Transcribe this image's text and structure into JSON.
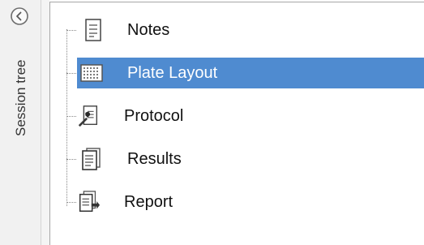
{
  "side_panel": {
    "title": "Session tree",
    "collapse_icon": "chevron-left-circle-icon"
  },
  "tree": {
    "items": [
      {
        "label": "Notes",
        "icon": "notes-icon",
        "selected": false
      },
      {
        "label": "Plate Layout",
        "icon": "grid-icon",
        "selected": true
      },
      {
        "label": "Protocol",
        "icon": "protocol-icon",
        "selected": false
      },
      {
        "label": "Results",
        "icon": "results-icon",
        "selected": false
      },
      {
        "label": "Report",
        "icon": "report-icon",
        "selected": false
      }
    ]
  },
  "colors": {
    "selection": "#4f8bd0",
    "panel_bg": "#f1f1f1"
  }
}
